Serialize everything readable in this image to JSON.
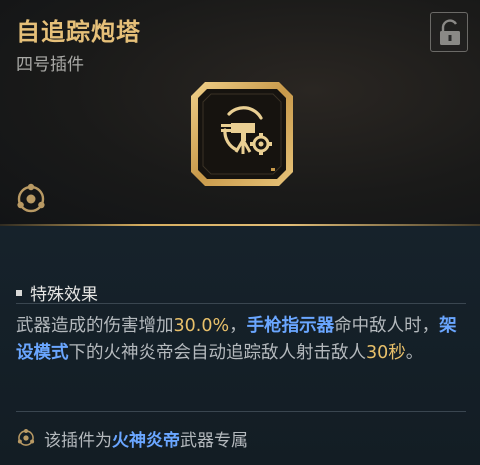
{
  "item": {
    "name": "自追踪炮塔",
    "slot": "四号插件",
    "icon": "turret-plugin-icon",
    "type_icon": "plugin-type-icon"
  },
  "lock": {
    "icon": "unlock-icon"
  },
  "effect": {
    "heading": "特殊效果",
    "segments": [
      {
        "text": "武器造成的伤害增加",
        "style": "plain"
      },
      {
        "text": "30.0%",
        "style": "gold"
      },
      {
        "text": "，",
        "style": "plain"
      },
      {
        "text": "手枪指示器",
        "style": "blue"
      },
      {
        "text": "命中敌人时，",
        "style": "plain"
      },
      {
        "text": "架设模式",
        "style": "blue"
      },
      {
        "text": "下的火神炎帝会自动追踪敌人射击敌人",
        "style": "plain"
      },
      {
        "text": "30秒",
        "style": "gold"
      },
      {
        "text": "。",
        "style": "plain"
      }
    ]
  },
  "footer": {
    "icon": "weapon-exclusive-icon",
    "prefix": "该插件为",
    "weapon": "火神炎帝",
    "suffix": "武器专属"
  },
  "colors": {
    "title": "#e6c079",
    "gold_highlight": "#e8c06a",
    "blue_highlight": "#6aa6ff",
    "gold_line": "#d6ae60"
  }
}
